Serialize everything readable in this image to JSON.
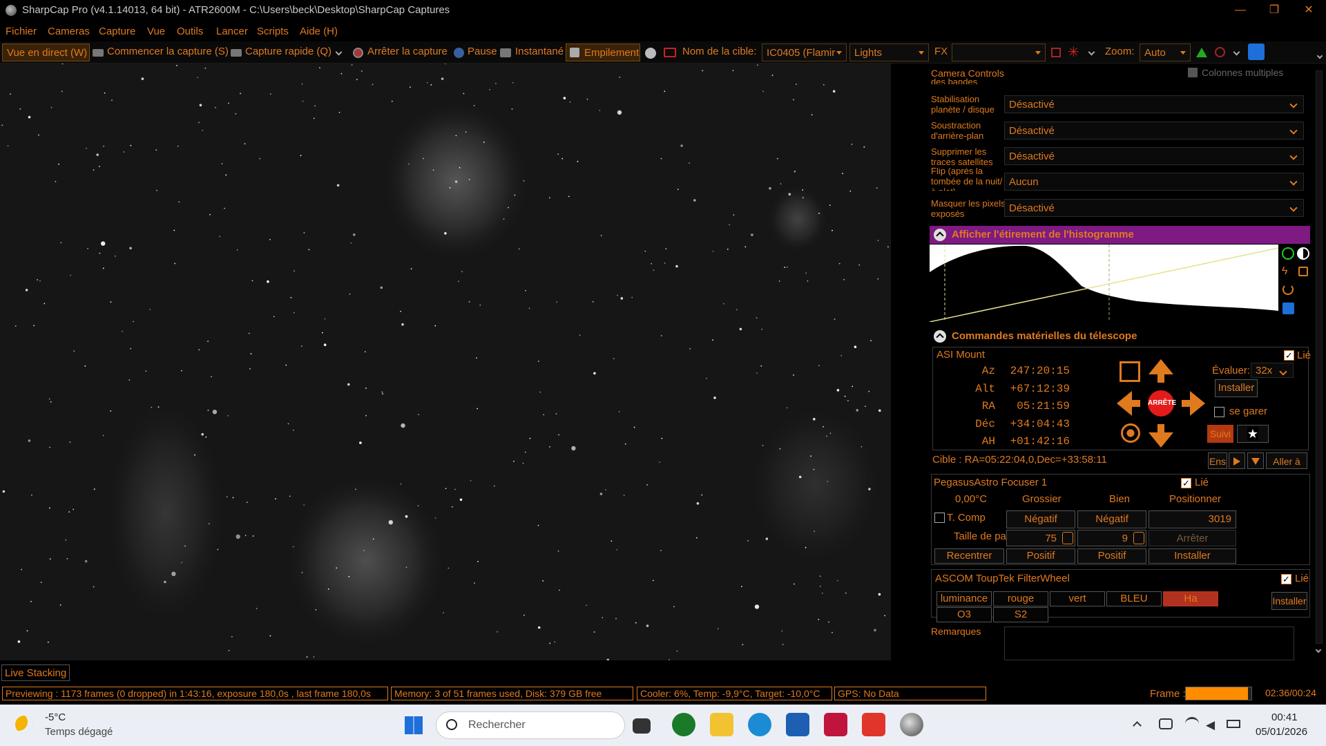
{
  "window": {
    "title": "SharpCap Pro (v4.1.14013, 64 bit) - ATR2600M - C:\\Users\\beck\\Desktop\\SharpCap Captures",
    "minimize": "—",
    "maximize": "❐",
    "close": "✕"
  },
  "menu": {
    "items": [
      "Fichier",
      "Cameras",
      "Capture",
      "Vue",
      "Outils",
      "Lancer",
      "Scripts",
      "Aide (H)"
    ]
  },
  "toolbar": {
    "live_view": "Vue en direct (W)",
    "start_capture": "Commencer la capture (S)",
    "quick_capture": "Capture rapide (Q)",
    "stop_capture": "Arrêter la capture",
    "pause": "Pause",
    "snapshot": "Instantané",
    "stacking": "Empilement",
    "target_label": "Nom de la cible:",
    "target_value": "IC0405 (Flamir",
    "frame_type": "Lights",
    "fx_label": "FX",
    "fx_value": "",
    "zoom_label": "Zoom:",
    "zoom_value": "Auto"
  },
  "camera_controls": {
    "title": "Camera Controls",
    "multi_columns": "Colonnes multiples",
    "partial_label": "des bandes",
    "rows": [
      {
        "label": "Stabilisation planète / disque",
        "value": "Désactivé"
      },
      {
        "label": "Soustraction d'arrière-plan",
        "value": "Désactivé"
      },
      {
        "label": "Supprimer les traces satellites",
        "value": "Désactivé"
      },
      {
        "label": "Flip (après la tombée de la nuit/à plat)",
        "value": "Aucun"
      },
      {
        "label": "Masquer les pixels exposés",
        "value": "Désactivé"
      }
    ]
  },
  "histogram": {
    "title": "Afficher l'étirement de l'histogramme"
  },
  "telescope": {
    "title": "Commandes matérielles du télescope",
    "mount_name": "ASI Mount",
    "linked_label": "Lié",
    "coords": [
      {
        "label": "Az",
        "value": "247:20:15"
      },
      {
        "label": "Alt",
        "value": "+67:12:39"
      },
      {
        "label": "RA",
        "value": "05:21:59"
      },
      {
        "label": "Déc",
        "value": "+34:04:43"
      },
      {
        "label": "AH",
        "value": "+01:42:16"
      }
    ],
    "stop_label": "ARRÊTE",
    "rate_label": "Évaluer:",
    "rate_value": "32x",
    "install": "Installer",
    "park": "se garer",
    "tracking": "Suivi",
    "ens": "Ens",
    "goto": "Aller à",
    "target": "Cible : RA=05:22:04,0,Dec=+33:58:11"
  },
  "focuser": {
    "name": "PegasusAstro Focuser 1",
    "linked_label": "Lié",
    "temperature": "0,00°C",
    "col_coarse": "Grossier",
    "col_fine": "Bien",
    "col_position": "Positionner",
    "tcomp": "T. Comp",
    "negative": "Négatif",
    "position_value": "3019",
    "step_size_label": "Taille de pas",
    "coarse_step": "75",
    "fine_step": "9",
    "stop": "Arrêter",
    "recenter": "Recentrer",
    "positive": "Positif",
    "install": "Installer"
  },
  "filterwheel": {
    "name": "ASCOM ToupTek FilterWheel",
    "linked_label": "Lié",
    "filters": [
      "luminance",
      "rouge",
      "vert",
      "BLEU",
      "Ha",
      "O3",
      "S2"
    ],
    "active_filter": "Ha",
    "install": "Installer"
  },
  "notes": {
    "label": "Remarques"
  },
  "live_stacking_tab": "Live Stacking",
  "status": {
    "preview": "Previewing : 1173 frames (0 dropped) in 1:43:16, exposure 180,0s , last frame 180,0s",
    "memory": "Memory: 3 of 51 frames used, Disk: 379 GB free",
    "cooler": "Cooler: 6%, Temp: -9,9°C, Target: -10,0°C",
    "gps": "GPS: No Data",
    "frame_label": "Frame :",
    "frame_time": "02:36/00:24",
    "frame_progress": 0.95
  },
  "taskbar": {
    "weather_temp": "-5°C",
    "weather_desc": "Temps dégagé",
    "search_placeholder": "Rechercher",
    "time": "00:41",
    "date": "05/01/2026"
  },
  "colors": {
    "accent": "#e07a1f",
    "histogram_header": "#8a1a8a",
    "active_filter": "#b3321f"
  }
}
